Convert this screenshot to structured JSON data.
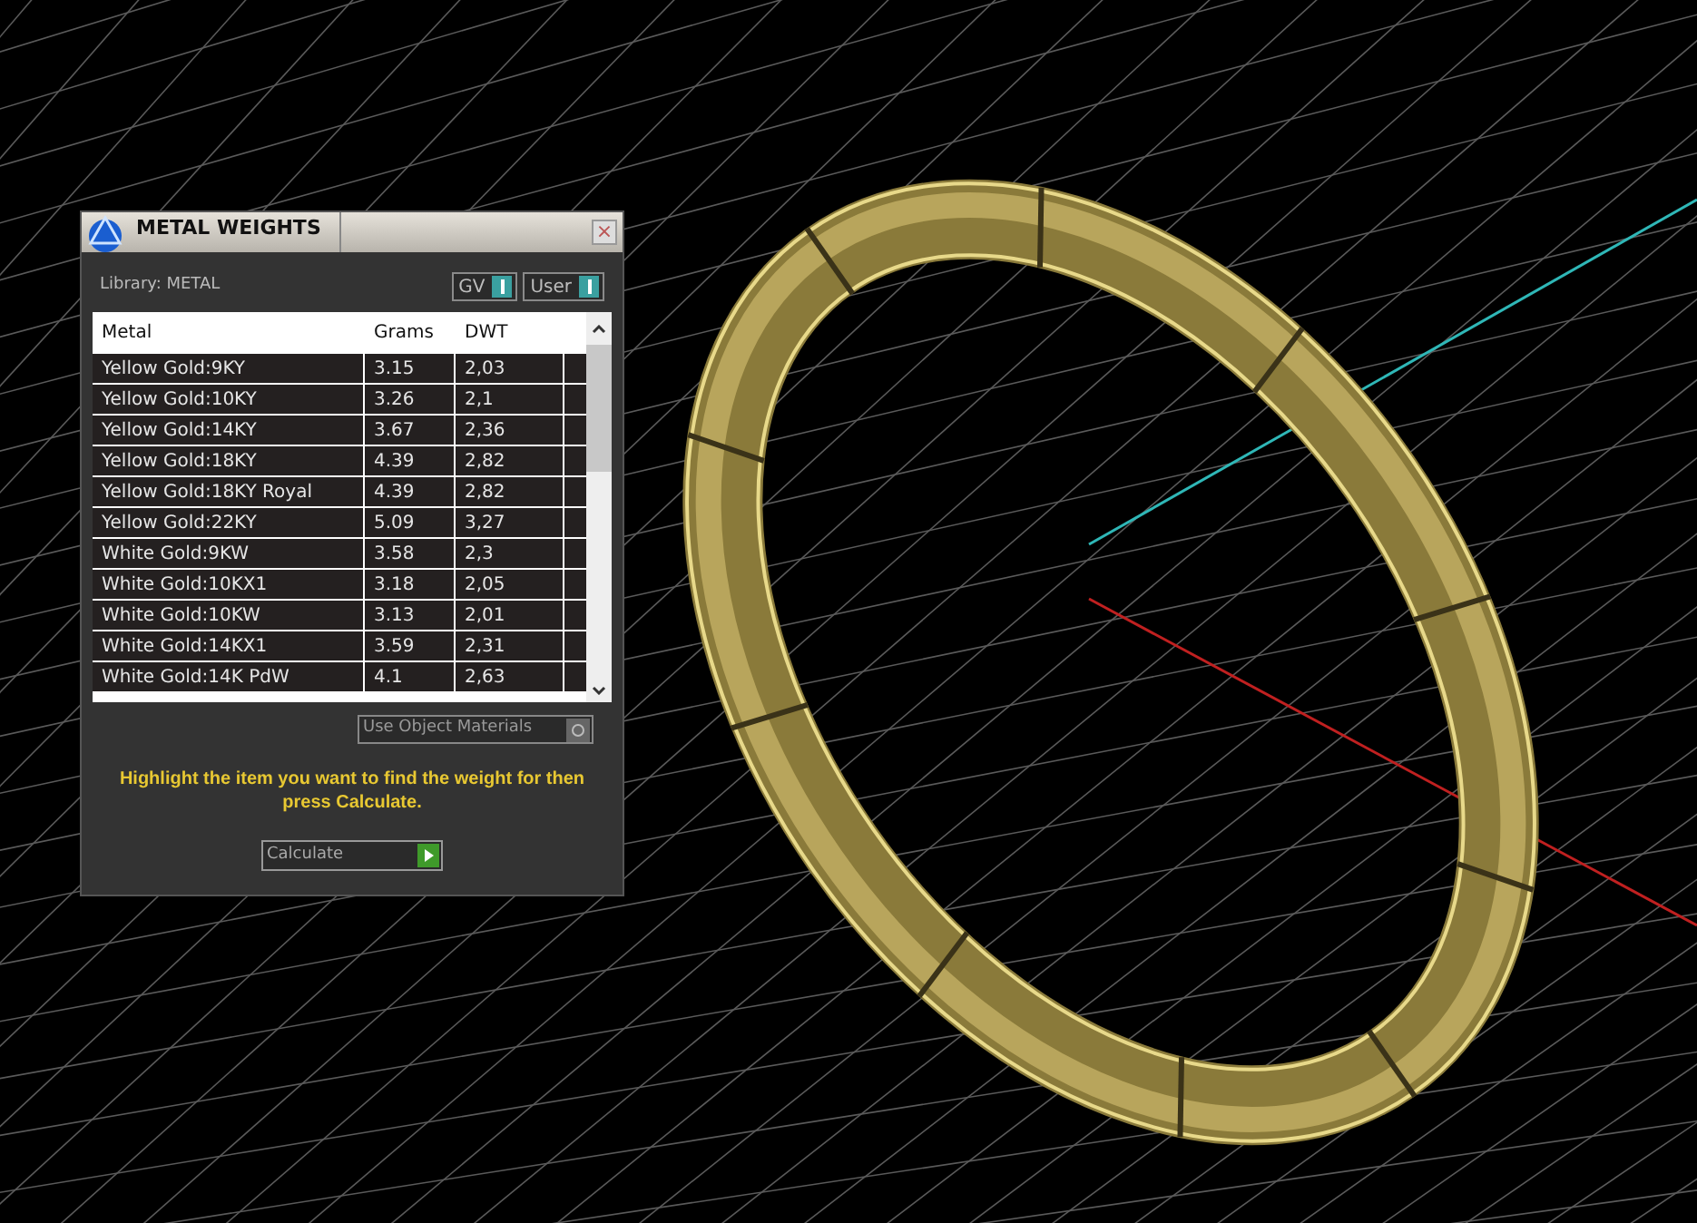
{
  "panel": {
    "title": "METAL WEIGHTS",
    "close": "×",
    "library_label": "Library: METAL",
    "toggles": [
      {
        "label": "GV",
        "on": true
      },
      {
        "label": "User",
        "on": true
      }
    ],
    "table": {
      "columns": [
        "Metal",
        "Grams",
        "DWT"
      ],
      "rows": [
        [
          "Yellow Gold:9KY",
          "3.15",
          "2,03"
        ],
        [
          "Yellow Gold:10KY",
          "3.26",
          "2,1"
        ],
        [
          "Yellow Gold:14KY",
          "3.67",
          "2,36"
        ],
        [
          "Yellow Gold:18KY",
          "4.39",
          "2,82"
        ],
        [
          "Yellow Gold:18KY Royal",
          "4.39",
          "2,82"
        ],
        [
          "Yellow Gold:22KY",
          "5.09",
          "3,27"
        ],
        [
          "White Gold:9KW",
          "3.58",
          "2,3"
        ],
        [
          "White Gold:10KX1",
          "3.18",
          "2,05"
        ],
        [
          "White Gold:10KW",
          "3.13",
          "2,01"
        ],
        [
          "White Gold:14KX1",
          "3.59",
          "2,31"
        ],
        [
          "White Gold:14K PdW",
          "4.1",
          "2,63"
        ]
      ]
    },
    "use_object_materials": {
      "label": "Use Object Materials",
      "on": false
    },
    "hint": "Highlight the item you want to find the weight for then press Calculate.",
    "calculate": "Calculate"
  }
}
